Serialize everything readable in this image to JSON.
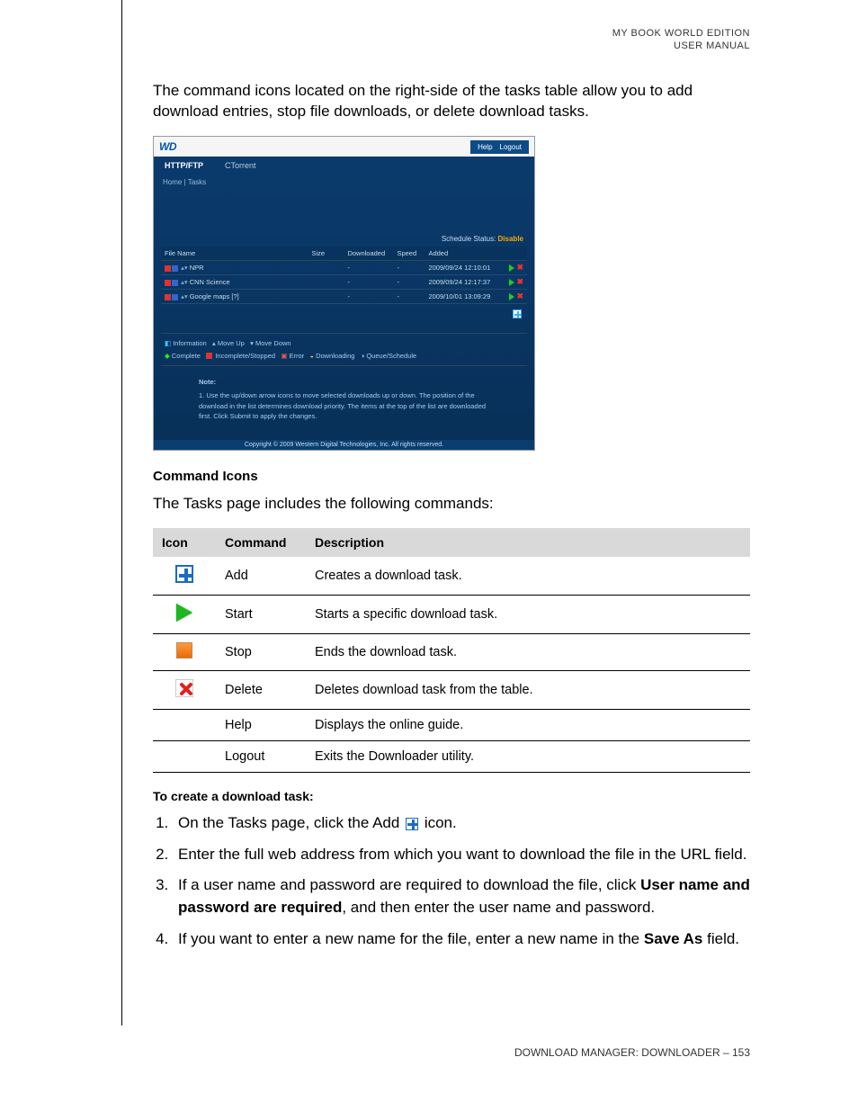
{
  "header": {
    "line1": "MY BOOK WORLD EDITION",
    "line2": "USER MANUAL"
  },
  "intro": "The command icons located on the right-side of the tasks table allow you to add download entries, stop file downloads, or delete download tasks.",
  "screenshot": {
    "wd_logo": "WD",
    "help": "Help",
    "logout": "Logout",
    "tab1": "HTTP/FTP",
    "tab2": "CTorrent",
    "breadcrumb": "Home | Tasks",
    "schedule_status_label": "Schedule Status:",
    "schedule_status_value": "Disable",
    "cols": {
      "file": "File Name",
      "size": "Size",
      "downloaded": "Downloaded",
      "speed": "Speed",
      "added": "Added"
    },
    "rows": [
      {
        "name": "NPR",
        "size": "",
        "dl": "-",
        "sp": "-",
        "added": "2009/09/24 12:10:01"
      },
      {
        "name": "CNN Science",
        "size": "",
        "dl": "-",
        "sp": "-",
        "added": "2009/09/24 12:17:37"
      },
      {
        "name": "Google maps [?]",
        "size": "",
        "dl": "-",
        "sp": "-",
        "added": "2009/10/01 13:09:29"
      }
    ],
    "legend": {
      "information": "Information",
      "move_up": "Move Up",
      "move_down": "Move Down",
      "complete": "Complete",
      "incomplete": "Incomplete/Stopped",
      "error": "Error",
      "downloading": "Downloading",
      "queue": "Queue/Schedule"
    },
    "note_title": "Note:",
    "note_body": "1. Use the up/down arrow icons to move selected downloads up or down. The position of the download in the list determines download priority. The items at the top of the list are downloaded first. Click Submit to apply the changes.",
    "copyright": "Copyright © 2009 Western Digital Technologies, Inc. All rights reserved."
  },
  "section_command_icons": "Command Icons",
  "tasks_intro": "The Tasks page includes the following commands:",
  "cmd_table": {
    "h_icon": "Icon",
    "h_cmd": "Command",
    "h_desc": "Description",
    "rows": [
      {
        "icon": "add",
        "cmd": "Add",
        "desc": "Creates a download task."
      },
      {
        "icon": "start",
        "cmd": "Start",
        "desc": "Starts a specific download task."
      },
      {
        "icon": "stop",
        "cmd": "Stop",
        "desc": "Ends the download task."
      },
      {
        "icon": "delete",
        "cmd": "Delete",
        "desc": "Deletes download task from the table."
      },
      {
        "icon": "",
        "cmd": "Help",
        "desc": "Displays the online guide."
      },
      {
        "icon": "",
        "cmd": "Logout",
        "desc": "Exits the Downloader utility."
      }
    ]
  },
  "create_task_title": "To create a download task:",
  "steps": {
    "s1a": "On the Tasks page, click the Add",
    "s1b": "icon.",
    "s2": "Enter the full web address from which you want to download the file in the URL field.",
    "s3a": "If a user name and password are required to download the file, click ",
    "s3b": "User name and password are required",
    "s3c": ", and then enter the user name and password.",
    "s4a": "If you want to enter a new name for the file, enter a new name in the ",
    "s4b": "Save As",
    "s4c": " field."
  },
  "footer": "DOWNLOAD MANAGER: DOWNLOADER – 153"
}
